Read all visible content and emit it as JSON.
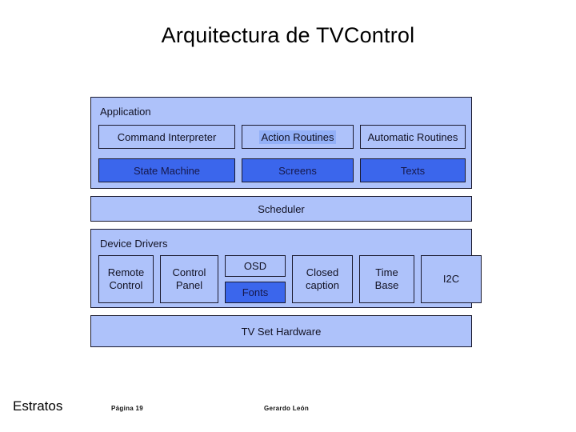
{
  "slide": {
    "title": "Arquitectura de TVControl"
  },
  "colors": {
    "layer_fill": "#aec2fa",
    "block_fill_dark": "#3b66ec",
    "border": "#1a1a2e",
    "selection_highlight": "#93b0f7",
    "background": "#ffffff"
  },
  "diagram": {
    "application": {
      "caption": "Application",
      "row1": [
        {
          "label": "Command Interpreter",
          "style": "light",
          "highlighted": false
        },
        {
          "label": "Action Routines",
          "style": "light",
          "highlighted": true
        },
        {
          "label": "Automatic Routines",
          "style": "light",
          "highlighted": false
        }
      ],
      "row2": [
        {
          "label": "State Machine",
          "style": "dark",
          "highlighted": false
        },
        {
          "label": "Screens",
          "style": "dark",
          "highlighted": false
        },
        {
          "label": "Texts",
          "style": "dark",
          "highlighted": false
        }
      ]
    },
    "scheduler": {
      "label": "Scheduler"
    },
    "device_drivers": {
      "caption": "Device Drivers",
      "boxes": [
        {
          "label": "Remote Control",
          "line1": "Remote",
          "line2": "Control",
          "style": "light"
        },
        {
          "label": "Control Panel",
          "line1": "Control",
          "line2": "Panel",
          "style": "light"
        },
        {
          "label": "OSD",
          "sub": "Fonts",
          "style": "light",
          "sub_style": "dark"
        },
        {
          "label": "Closed caption",
          "line1": "Closed",
          "line2": "caption",
          "style": "light"
        },
        {
          "label": "Time Base",
          "line1": "Time",
          "line2": "Base",
          "style": "light"
        },
        {
          "label": "I2C",
          "line1": "I2C",
          "line2": "",
          "style": "light"
        }
      ]
    },
    "hardware": {
      "label": "TV Set Hardware"
    }
  },
  "footer": {
    "section_label": "Estratos",
    "page_label": "Página 19",
    "author": "Gerardo León"
  }
}
